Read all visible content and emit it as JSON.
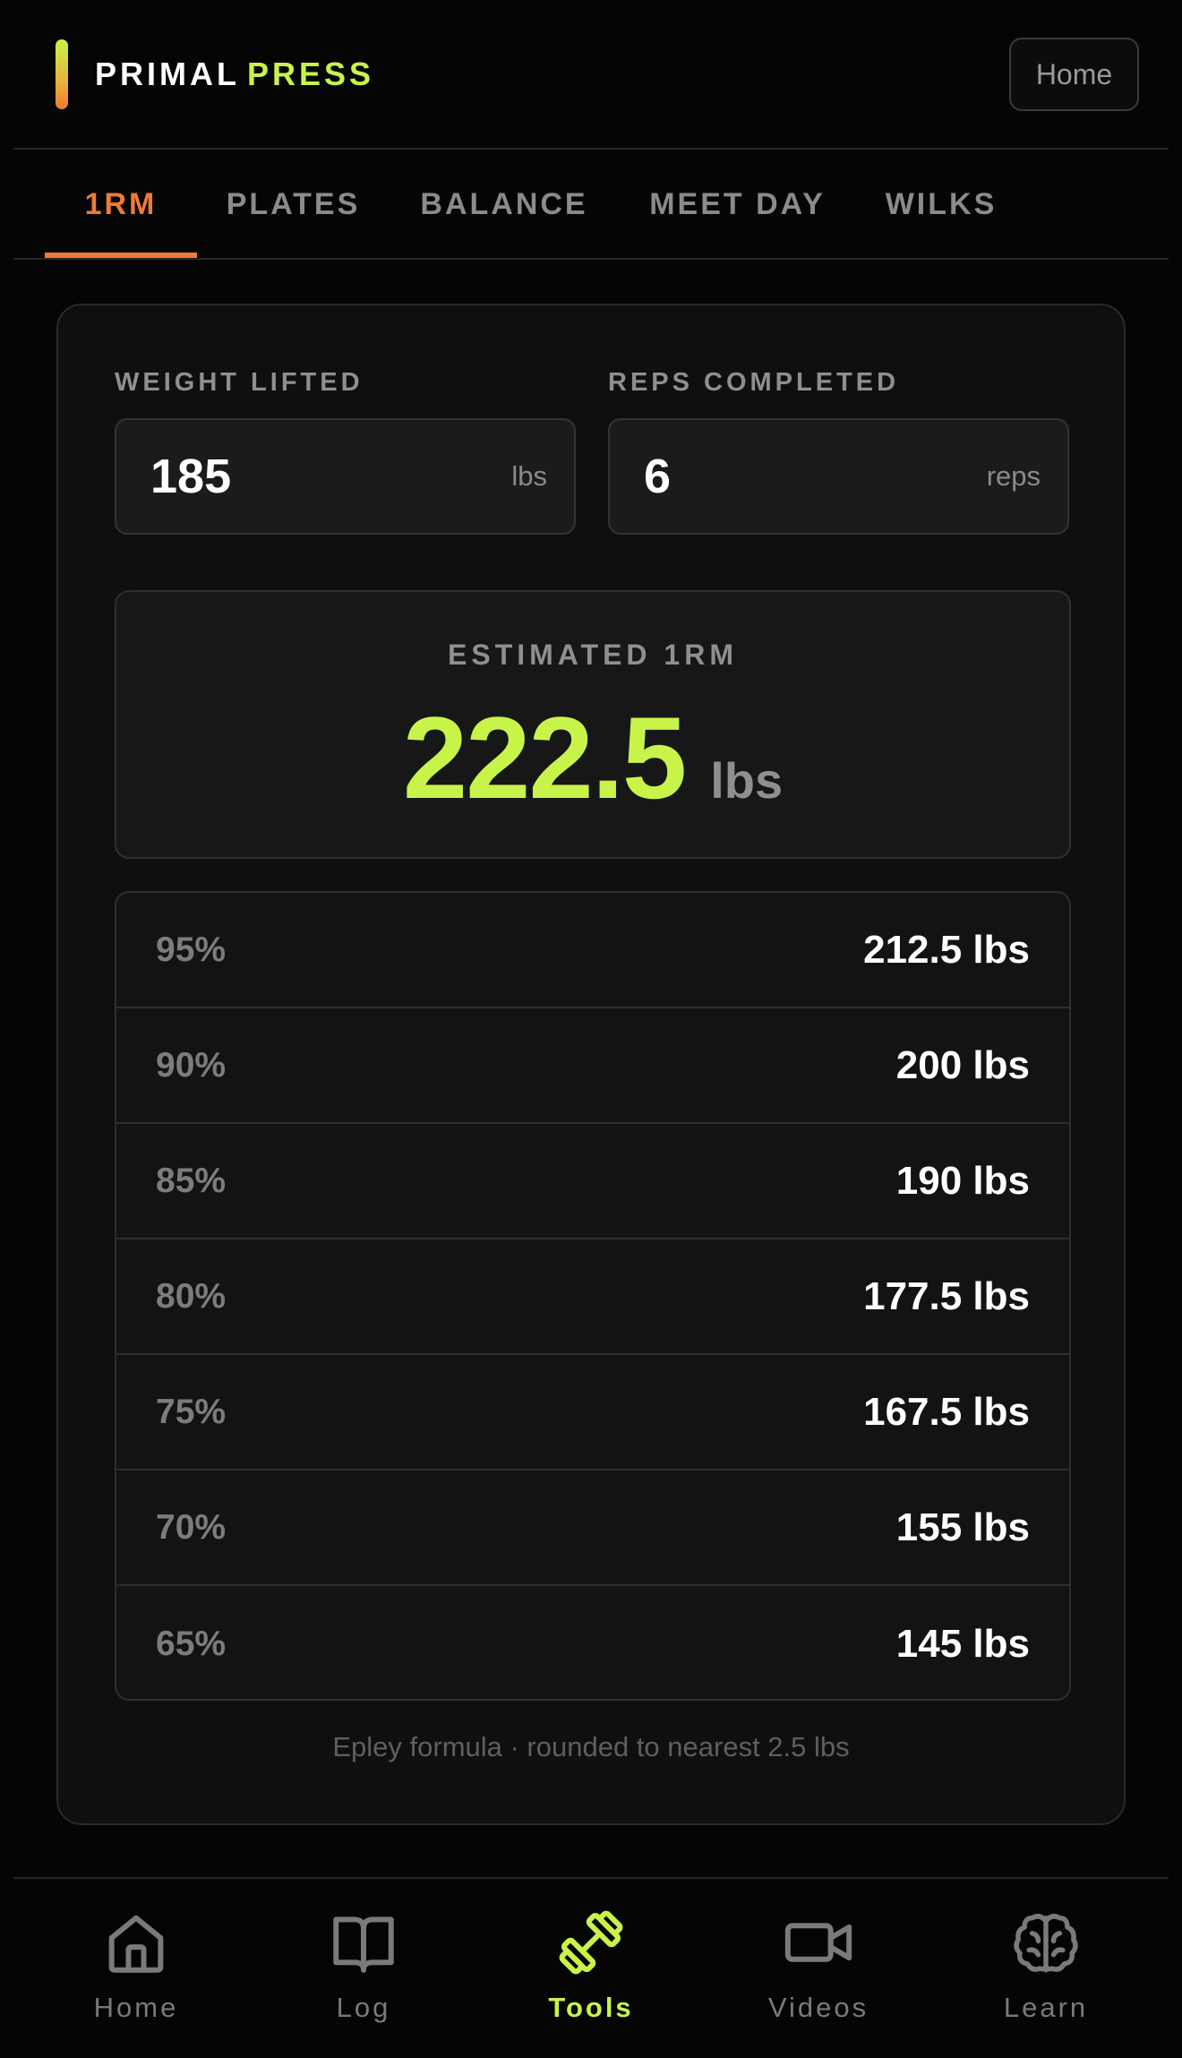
{
  "header": {
    "brand_word1": "PRIMAL",
    "brand_word2": "PRESS",
    "home_button": "Home"
  },
  "tabs": [
    {
      "label": "1RM",
      "active": true
    },
    {
      "label": "PLATES",
      "active": false
    },
    {
      "label": "BALANCE",
      "active": false
    },
    {
      "label": "MEET DAY",
      "active": false
    },
    {
      "label": "WILKS",
      "active": false
    }
  ],
  "calculator": {
    "weight_label": "WEIGHT LIFTED",
    "weight_value": "185",
    "weight_unit": "lbs",
    "reps_label": "REPS COMPLETED",
    "reps_value": "6",
    "reps_unit": "reps",
    "result_label": "ESTIMATED 1RM",
    "result_value": "222.5",
    "result_unit": "lbs",
    "percentages": [
      {
        "pct": "95%",
        "weight": "212.5 lbs"
      },
      {
        "pct": "90%",
        "weight": "200 lbs"
      },
      {
        "pct": "85%",
        "weight": "190 lbs"
      },
      {
        "pct": "80%",
        "weight": "177.5 lbs"
      },
      {
        "pct": "75%",
        "weight": "167.5 lbs"
      },
      {
        "pct": "70%",
        "weight": "155 lbs"
      },
      {
        "pct": "65%",
        "weight": "145 lbs"
      }
    ],
    "footnote": "Epley formula · rounded to nearest 2.5 lbs"
  },
  "nav": [
    {
      "label": "Home",
      "icon": "home-icon",
      "active": false
    },
    {
      "label": "Log",
      "icon": "book-icon",
      "active": false
    },
    {
      "label": "Tools",
      "icon": "dumbbell-icon",
      "active": true
    },
    {
      "label": "Videos",
      "icon": "video-camera-icon",
      "active": false
    },
    {
      "label": "Learn",
      "icon": "brain-icon",
      "active": false
    }
  ],
  "colors": {
    "accent_lime": "#c8f44a",
    "accent_orange": "#ef7a38",
    "background": "#050505"
  }
}
